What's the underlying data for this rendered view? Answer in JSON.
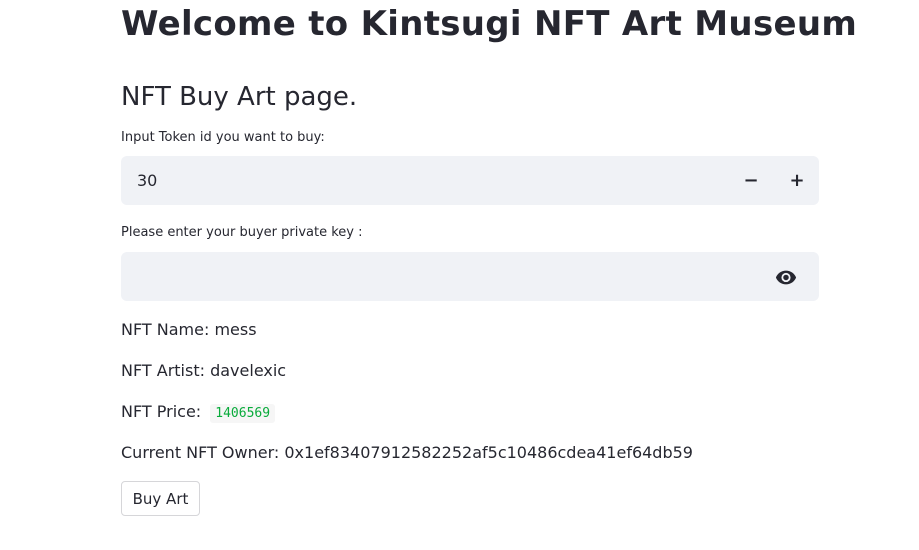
{
  "page": {
    "title": "Welcome to Kintsugi NFT Art Museum",
    "subtitle": "NFT Buy Art page."
  },
  "token_input": {
    "label": "Input Token id you want to buy:",
    "value": "30",
    "decrement_label": "−",
    "increment_label": "+"
  },
  "private_key_input": {
    "label": "Please enter your buyer private key :",
    "value": "",
    "icon": "eye-icon"
  },
  "nft_info": {
    "name_label": "NFT Name:",
    "name_value": "mess",
    "artist_label": "NFT Artist:",
    "artist_value": "davelexic",
    "price_label": "NFT Price:",
    "price_value": "1406569",
    "owner_label": "Current NFT Owner:",
    "owner_value": "0x1ef83407912582252af5c10486cdea41ef64db59"
  },
  "buy_button": {
    "label": "Buy Art"
  },
  "colors": {
    "text": "#262730",
    "input_bg": "#f0f2f6",
    "code_green": "#09ab3b"
  }
}
